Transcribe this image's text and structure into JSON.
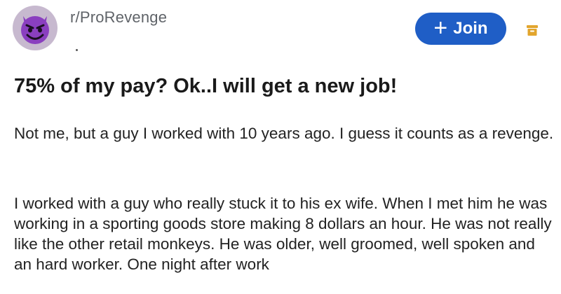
{
  "post": {
    "subreddit": "r/ProRevenge",
    "join_label": "Join",
    "title": "75% of my pay? Ok..I will get a new job!",
    "paragraphs": [
      "Not me, but a guy I worked with 10 years ago. I guess it counts as a revenge.",
      "I worked with a guy who really stuck it to his ex wife. When I met him he was working in a sporting goods store making 8 dollars an hour. He was not really like the other retail monkeys. He was older, well groomed, well spoken and an hard worker. One night after work"
    ]
  },
  "icons": {
    "avatar": "devil-face-icon",
    "join": "plus-icon",
    "save": "archive-icon"
  },
  "colors": {
    "join_button": "#1f5ec6",
    "archive_icon": "#e2a52d",
    "avatar_face": "#8a3fbf"
  }
}
